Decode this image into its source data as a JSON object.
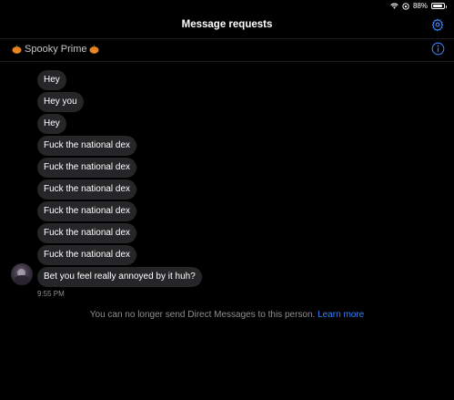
{
  "status": {
    "battery": "88%",
    "battery_level": 0.88
  },
  "header": {
    "title": "Message requests",
    "settings_icon": "gear-icon"
  },
  "thread": {
    "name": "Spooky Prime",
    "info_icon": "info-icon"
  },
  "messages": [
    "Hey",
    "Hey you",
    "Hey",
    "Fuck the national dex",
    "Fuck the national dex",
    "Fuck the national dex",
    "Fuck the national dex",
    "Fuck the national dex",
    "Fuck the national dex",
    "Bet you feel really annoyed by it huh?"
  ],
  "timestamp": "9:55 PM",
  "notice": {
    "text": "You can no longer send Direct Messages to this person.",
    "link": "Learn more"
  },
  "colors": {
    "background": "#000000",
    "bubble": "#262628",
    "accent": "#3b82f6",
    "muted": "#8e8e93"
  }
}
